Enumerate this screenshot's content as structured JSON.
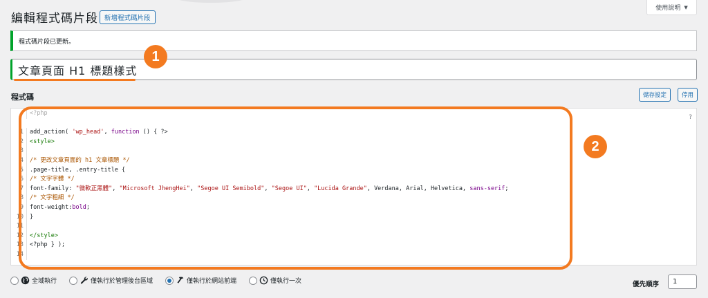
{
  "header": {
    "title": "編輯程式碼片段",
    "add_new_label": "新增程式碼片段",
    "help_label": "使用說明"
  },
  "notice": {
    "text": "程式碼片段已更新。",
    "color": "#00a32a"
  },
  "snippet": {
    "title_value": "文章頁面 H1 標題樣式"
  },
  "annotations": {
    "badge_1": "1",
    "badge_2": "2",
    "accent_color": "#f37a20"
  },
  "code_section": {
    "label": "程式碼",
    "save_label": "儲存設定",
    "disable_label": "停用",
    "help_mark": "?",
    "header_text": "<?php",
    "lines": [
      {
        "n": "1",
        "tokens": [
          [
            "plain",
            "add_action( "
          ],
          [
            "string",
            "'wp_head'"
          ],
          [
            "plain",
            ", "
          ],
          [
            "keyword",
            "function"
          ],
          [
            "plain",
            " () { ?>"
          ]
        ]
      },
      {
        "n": "2",
        "tokens": [
          [
            "tag",
            "<style>"
          ]
        ]
      },
      {
        "n": "3",
        "tokens": []
      },
      {
        "n": "4",
        "tokens": [
          [
            "comment",
            "/* 更改文章頁面的 h1 文章標題 */"
          ]
        ]
      },
      {
        "n": "5",
        "tokens": [
          [
            "plain",
            ".page-title, .entry-title {"
          ]
        ]
      },
      {
        "n": "6",
        "tokens": [
          [
            "comment",
            "/* 文字字體 */"
          ]
        ]
      },
      {
        "n": "7",
        "tokens": [
          [
            "plain",
            "font-family: "
          ],
          [
            "string",
            "\"微軟正黑體\""
          ],
          [
            "plain",
            ", "
          ],
          [
            "string",
            "\"Microsoft JhengHei\""
          ],
          [
            "plain",
            ", "
          ],
          [
            "string",
            "\"Segoe UI Semibold\""
          ],
          [
            "plain",
            ", "
          ],
          [
            "string",
            "\"Segoe UI\""
          ],
          [
            "plain",
            ", "
          ],
          [
            "string",
            "\"Lucida Grande\""
          ],
          [
            "plain",
            ", Verdana, Arial, Helvetica, "
          ],
          [
            "keyword",
            "sans-serif"
          ],
          [
            "plain",
            ";"
          ]
        ]
      },
      {
        "n": "8",
        "tokens": [
          [
            "comment",
            "/* 文字粗細 */"
          ]
        ]
      },
      {
        "n": "9",
        "tokens": [
          [
            "plain",
            "font-weight:"
          ],
          [
            "keyword",
            "bold"
          ],
          [
            "plain",
            ";"
          ]
        ]
      },
      {
        "n": "10",
        "tokens": [
          [
            "plain",
            "}"
          ]
        ]
      },
      {
        "n": "11",
        "tokens": []
      },
      {
        "n": "12",
        "tokens": [
          [
            "tag",
            "</style>"
          ]
        ]
      },
      {
        "n": "13",
        "tokens": [
          [
            "plain",
            "<?php } );"
          ]
        ]
      },
      {
        "n": "14",
        "tokens": []
      }
    ]
  },
  "scope": {
    "options": [
      {
        "label": "全域執行",
        "icon": "globe-icon",
        "checked": false
      },
      {
        "label": "僅執行於管理後台區域",
        "icon": "wrench-icon",
        "checked": false
      },
      {
        "label": "僅執行於網站前端",
        "icon": "hammer-icon",
        "checked": true
      },
      {
        "label": "僅執行一次",
        "icon": "clock-icon",
        "checked": false
      }
    ]
  },
  "priority": {
    "label": "優先順序",
    "value": "1"
  }
}
